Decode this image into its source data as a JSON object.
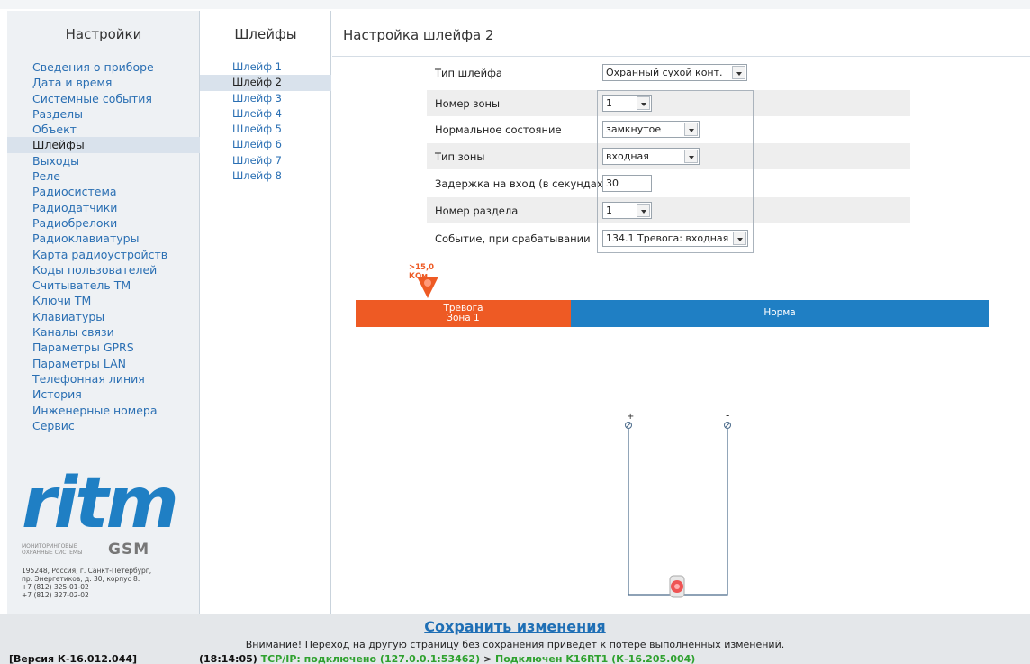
{
  "sidebar": {
    "title": "Настройки",
    "items": [
      {
        "label": "Сведения о приборе"
      },
      {
        "label": "Дата и время"
      },
      {
        "label": "Системные события"
      },
      {
        "label": "Разделы"
      },
      {
        "label": "Объект"
      },
      {
        "label": "Шлейфы",
        "active": true
      },
      {
        "label": "Выходы"
      },
      {
        "label": "Реле"
      },
      {
        "label": "Радиосистема"
      },
      {
        "label": "Радиодатчики"
      },
      {
        "label": "Радиобрелоки"
      },
      {
        "label": "Радиоклавиатуры"
      },
      {
        "label": "Карта радиоустройств"
      },
      {
        "label": "Коды пользователей"
      },
      {
        "label": "Считыватель ТМ"
      },
      {
        "label": "Ключи ТМ"
      },
      {
        "label": "Клавиатуры"
      },
      {
        "label": "Каналы связи"
      },
      {
        "label": "Параметры GPRS"
      },
      {
        "label": "Параметры LAN"
      },
      {
        "label": "Телефонная линия"
      },
      {
        "label": "История"
      },
      {
        "label": "Инженерные номера"
      },
      {
        "label": "Сервис"
      }
    ],
    "logo": {
      "text": "ritm",
      "sub_line1": "Мониторинговые",
      "sub_line2": "охранные системы",
      "gsm": "GSM"
    },
    "address": {
      "line1": "195248, Россия, г. Санкт-Петербург,",
      "line2": "пр. Энергетиков, д. 30, корпус 8.",
      "line3": "+7 (812) 325-01-02",
      "line4": "+7 (812) 327-02-02"
    }
  },
  "loops": {
    "title": "Шлейфы",
    "items": [
      {
        "label": "Шлейф 1"
      },
      {
        "label": "Шлейф 2",
        "active": true
      },
      {
        "label": "Шлейф 3"
      },
      {
        "label": "Шлейф 4"
      },
      {
        "label": "Шлейф 5"
      },
      {
        "label": "Шлейф 6"
      },
      {
        "label": "Шлейф 7"
      },
      {
        "label": "Шлейф 8"
      }
    ]
  },
  "main": {
    "title": "Настройка шлейфа 2",
    "fields": {
      "loop_type": {
        "label": "Тип шлейфа",
        "value": "Охранный сухой конт."
      },
      "zone_number": {
        "label": "Номер зоны",
        "value": "1"
      },
      "normal_state": {
        "label": "Нормальное состояние",
        "value": "замкнутое"
      },
      "zone_type": {
        "label": "Тип зоны",
        "value": "входная"
      },
      "entry_delay": {
        "label": "Задержка на вход (в секундах)",
        "value": "30"
      },
      "section_number": {
        "label": "Номер раздела",
        "value": "1"
      },
      "event_on_trigger": {
        "label": "Событие, при срабатывании",
        "value": "134.1 Тревога: входная"
      }
    },
    "scale": {
      "marker_label": "&gt;15,0 КОм",
      "alarm_line1": "Тревога",
      "alarm_line2": "Зона 1",
      "norm_label": "Норма"
    },
    "diagram": {
      "plus": "+",
      "minus": "-"
    }
  },
  "footer": {
    "save_label": "Сохранить изменения",
    "warning": "Внимание! Переход на другую страницу без сохранения приведет к потере выполненных изменений.",
    "version": "[Версия К-16.012.044]",
    "time": "(18:14:05)",
    "tcp": "TCP/IP: подключено (127.0.0.1:53462)",
    "separator": ">",
    "device": "Подключен K16RT1 (К-16.205.004)"
  },
  "colors": {
    "accent": "#1f7fc4",
    "alarm": "#ee5a24",
    "link": "#2a6fb3",
    "status_ok": "#2fa12f"
  }
}
